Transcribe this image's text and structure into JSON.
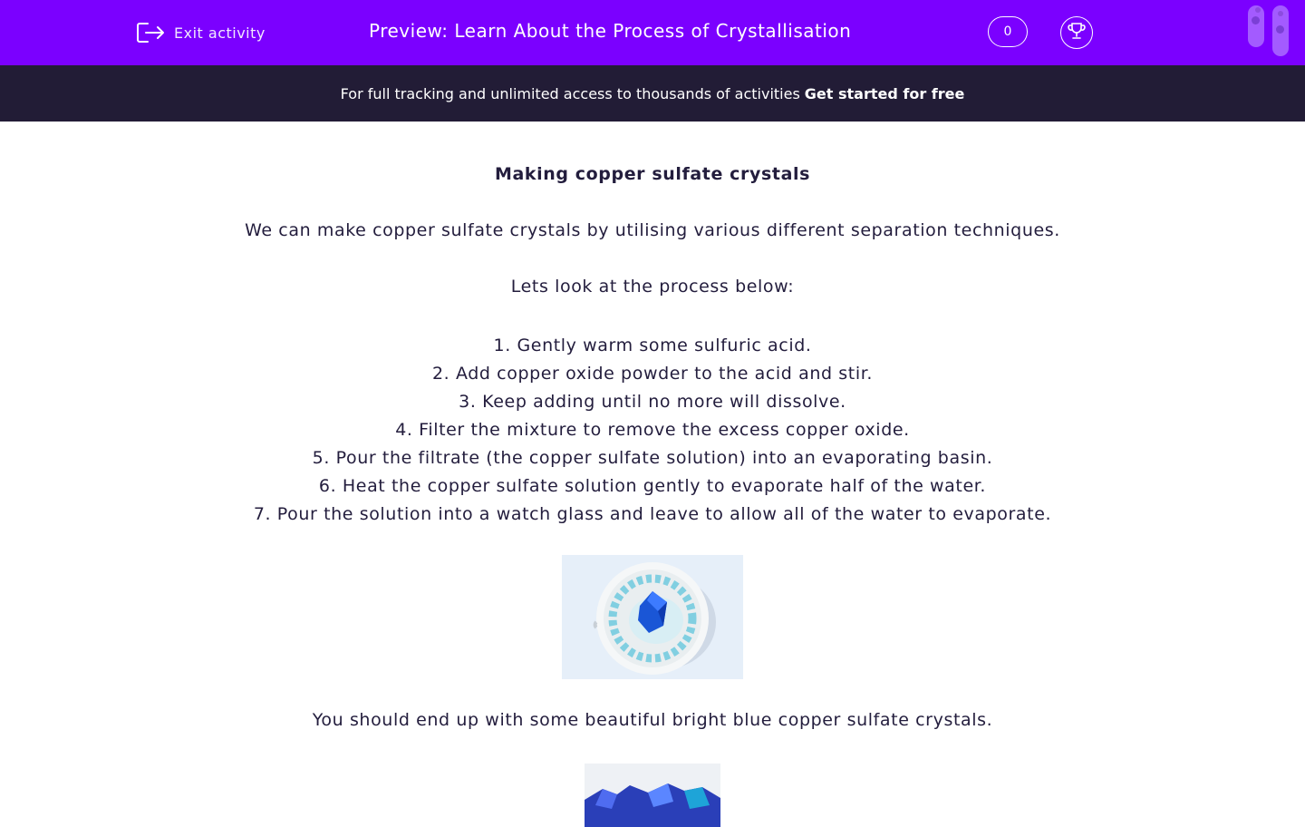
{
  "header": {
    "exit_label": "Exit activity",
    "title": "Preview: Learn About the Process of Crystallisation",
    "score": "0",
    "accent_color": "#7b00ff"
  },
  "banner": {
    "text": "For full tracking and unlimited access to thousands of activities",
    "cta": "Get started for free"
  },
  "content": {
    "heading": "Making copper sulfate crystals",
    "intro": "We can make copper sulfate crystals by utilising various different separation techniques.",
    "lead": "Lets look at the process below:",
    "steps": [
      "1. Gently warm some sulfuric acid.",
      "2. Add copper oxide powder to the acid and stir.",
      "3. Keep adding until no more will dissolve.",
      "4. Filter the mixture to remove the excess copper oxide.",
      "5. Pour the filtrate (the copper sulfate solution) into an evaporating basin.",
      "6. Heat the copper sulfate solution gently to evaporate half of the water.",
      "7. Pour the solution into a watch glass and leave to allow all of the water to evaporate."
    ],
    "conclusion": "You should end up with some beautiful bright blue copper sulfate crystals."
  },
  "icons": [
    "exit-icon",
    "trophy-icon",
    "test-tube-icon"
  ]
}
